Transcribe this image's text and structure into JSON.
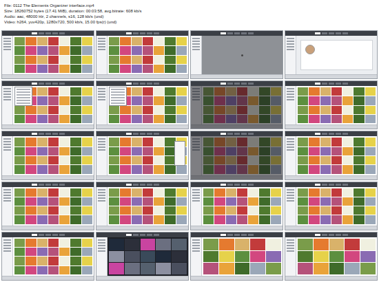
{
  "header": {
    "lines": [
      "File: 0112 The Elements Organizer interface.mp4",
      "Size: 18260752 bytes (17.41 MiB), duration: 00:03:58, avg.bitrate: 608 kb/s",
      "Audio: aac, 48000 Hz, 2 channels, s16, 128 kb/s (und)",
      "Video: h264, yuv420p, 1280x720, 500 kb/s, 15.00 fps(r) (und)"
    ]
  },
  "thumbnails": [
    {
      "kind": "grid"
    },
    {
      "kind": "grid"
    },
    {
      "kind": "blank"
    },
    {
      "kind": "signin"
    },
    {
      "kind": "menu"
    },
    {
      "kind": "menu"
    },
    {
      "kind": "dim"
    },
    {
      "kind": "grid"
    },
    {
      "kind": "grid"
    },
    {
      "kind": "popup"
    },
    {
      "kind": "dim"
    },
    {
      "kind": "grid"
    },
    {
      "kind": "grid"
    },
    {
      "kind": "grid"
    },
    {
      "kind": "grid"
    },
    {
      "kind": "grid"
    },
    {
      "kind": "grid"
    },
    {
      "kind": "photos"
    },
    {
      "kind": "zoom"
    },
    {
      "kind": "zoom"
    }
  ]
}
